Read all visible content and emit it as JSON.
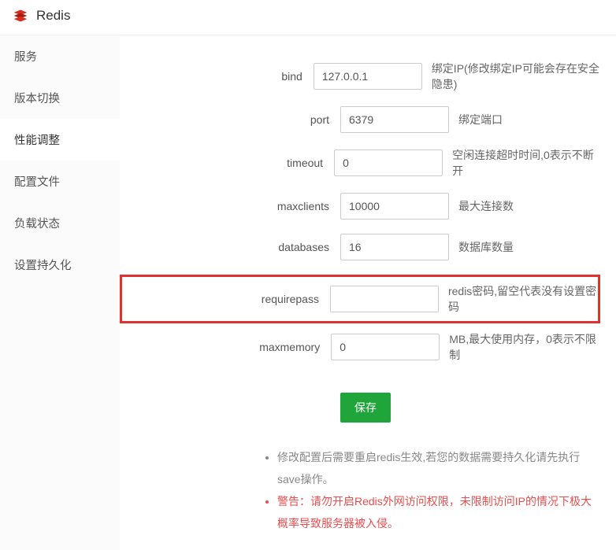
{
  "header": {
    "title": "Redis"
  },
  "sidebar": {
    "items": [
      {
        "label": "服务"
      },
      {
        "label": "版本切换"
      },
      {
        "label": "性能调整",
        "active": true
      },
      {
        "label": "配置文件"
      },
      {
        "label": "负载状态"
      },
      {
        "label": "设置持久化"
      }
    ]
  },
  "form": {
    "bind": {
      "label": "bind",
      "value": "127.0.0.1",
      "desc": "绑定IP(修改绑定IP可能会存在安全隐患)"
    },
    "port": {
      "label": "port",
      "value": "6379",
      "desc": "绑定端口"
    },
    "timeout": {
      "label": "timeout",
      "value": "0",
      "desc": "空闲连接超时时间,0表示不断开"
    },
    "maxclients": {
      "label": "maxclients",
      "value": "10000",
      "desc": "最大连接数"
    },
    "databases": {
      "label": "databases",
      "value": "16",
      "desc": "数据库数量"
    },
    "requirepass": {
      "label": "requirepass",
      "value": "",
      "desc": "redis密码,留空代表没有设置密码"
    },
    "maxmemory": {
      "label": "maxmemory",
      "value": "0",
      "desc": "MB,最大使用内存，0表示不限制"
    }
  },
  "buttons": {
    "save": "保存"
  },
  "notes": {
    "note1": "修改配置后需要重启redis生效,若您的数据需要持久化请先执行save操作。",
    "note2": "警告：请勿开启Redis外网访问权限，未限制访问IP的情况下极大概率导致服务器被入侵。"
  }
}
